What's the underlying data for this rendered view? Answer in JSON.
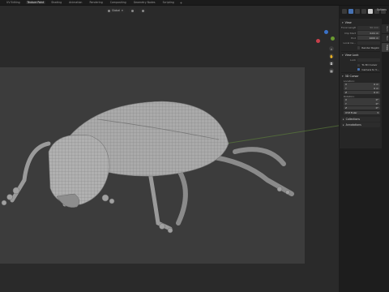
{
  "workspace_tabs": [
    "UV Editing",
    "Texture Paint",
    "Shading",
    "Animation",
    "Rendering",
    "Compositing",
    "Geometry Nodes",
    "Scripting"
  ],
  "active_tab_index": 1,
  "header": {
    "mode": "Global",
    "options": "Options"
  },
  "sidebar_tabs": [
    "Item",
    "Tool",
    "View"
  ],
  "npanel": {
    "view_section": "View",
    "focal_label": "Focal Length",
    "focal_value": "50 mm",
    "clip_label": "Clip Start",
    "clip_start": "0.01 m",
    "end_label": "End",
    "clip_end": "1000 m",
    "local_cam_label": "Local Ca...",
    "local_cam_value": "",
    "render_region": "Render Region",
    "view_lock_section": "View Lock",
    "lock_label": "Lock",
    "lock_to_3d_cursor": "To 3D Cursor",
    "camera_to_view": "Camera to V...",
    "cursor_section": "3D Cursor",
    "location_label": "Location:",
    "loc": [
      {
        "axis": "X",
        "value": "0 m"
      },
      {
        "axis": "Y",
        "value": "0 m"
      },
      {
        "axis": "Z",
        "value": "0 m"
      }
    ],
    "rotation_label": "Rotation:",
    "rot": [
      {
        "axis": "X",
        "value": "0°"
      },
      {
        "axis": "Y",
        "value": "0°"
      },
      {
        "axis": "Z",
        "value": "0°"
      }
    ],
    "rotation_mode": "XYZ Euler",
    "collections": "Collections",
    "annotations": "Annotations"
  },
  "colors": {
    "accent": "#4772b3",
    "axis_x": "#c8404b",
    "axis_y": "#6a9a30",
    "axis_z": "#3a72c8"
  },
  "icons": [
    "gizmo-axes-icon",
    "zoom-icon",
    "hand-pan-icon",
    "camera-icon",
    "grid-icon",
    "chevron-down-icon"
  ]
}
